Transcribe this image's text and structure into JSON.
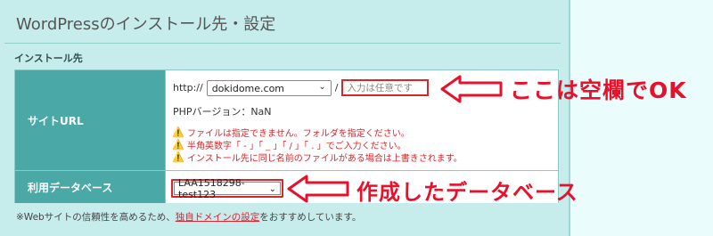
{
  "header": {
    "title": "WordPressのインストール先・設定"
  },
  "section": {
    "label": "インストール先"
  },
  "site_url": {
    "label": "サイトURL",
    "protocol": "http://",
    "domain_value": "dokidome.com",
    "separator": "/",
    "path_placeholder": "入力は任意です",
    "php_version": "PHPバージョン：NaN",
    "warnings": [
      "ファイルは指定できません。フォルダを指定ください。",
      "半角英数字「 - 」「 _ 」「 / 」「 . 」でご入力ください。",
      "インストール先に同じ名前のファイルがある場合は上書きされます。"
    ]
  },
  "database": {
    "label": "利用データベース",
    "selected": "LAA1518298-test123"
  },
  "footnote": {
    "prefix": "※Webサイトの信頼性を高めるため、",
    "link": "独自ドメインの設定",
    "suffix": "をおすすめしています。"
  },
  "annotations": {
    "callout_path": "ここは空欄でOK",
    "callout_db": "作成したデータベース"
  },
  "colors": {
    "panel_bg": "#c6eceb",
    "page_bg": "#ebfcfc",
    "label_bg": "#4aa8a6",
    "accent_red": "#d9262b"
  }
}
